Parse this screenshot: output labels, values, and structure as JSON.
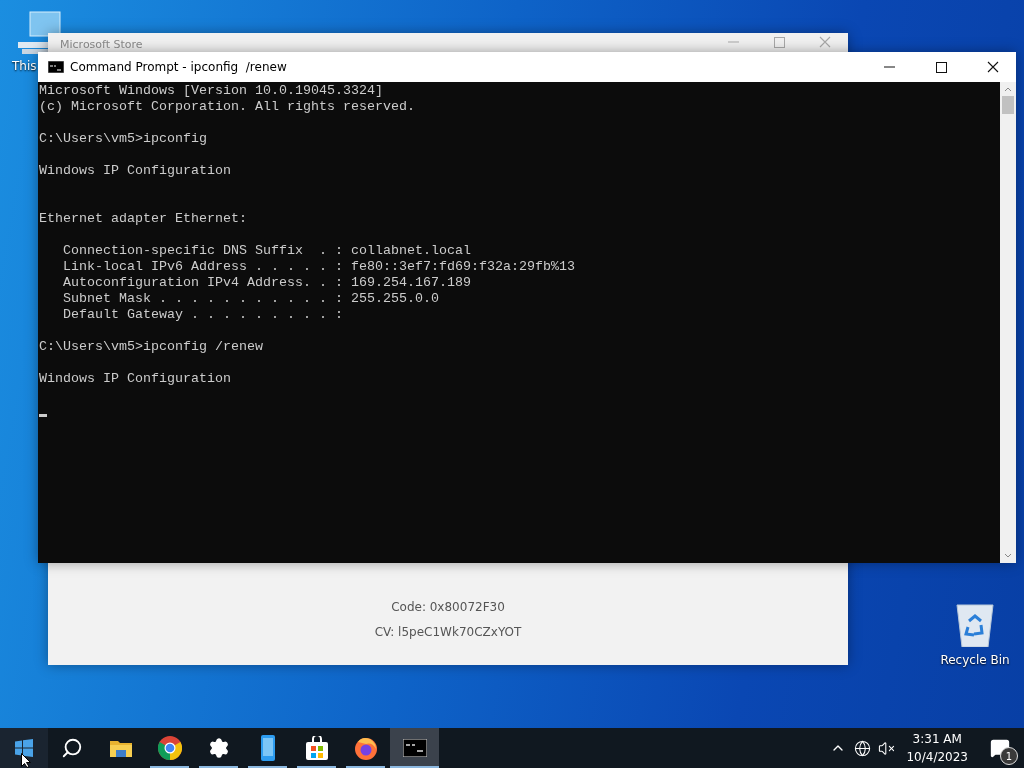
{
  "desktop_icons": [
    {
      "kind": "computer",
      "label": "This"
    },
    {
      "kind": "recycle",
      "label": "Recycle Bin"
    }
  ],
  "store_window": {
    "title": "Microsoft Store",
    "error_code": "Code: 0x80072F30",
    "cv": "CV: l5peC1Wk70CZxYOT"
  },
  "cmd_window": {
    "title": "Command Prompt - ipconfig  /renew",
    "blocks": [
      {
        "wide_gap": false,
        "lines": [
          "Microsoft Windows [Version 10.0.19045.3324]",
          "(c) Microsoft Corporation. All rights reserved."
        ]
      },
      {
        "wide_gap": false,
        "lines": [
          "C:\\Users\\vm5>ipconfig"
        ]
      },
      {
        "wide_gap": false,
        "lines": [
          "Windows IP Configuration"
        ]
      },
      {
        "wide_gap": true,
        "lines": [
          "Ethernet adapter Ethernet:"
        ]
      },
      {
        "wide_gap": false,
        "lines": [
          "   Connection-specific DNS Suffix  . : collabnet.local",
          "   Link-local IPv6 Address . . . . . : fe80::3ef7:fd69:f32a:29fb%13",
          "   Autoconfiguration IPv4 Address. . : 169.254.167.189",
          "   Subnet Mask . . . . . . . . . . . : 255.255.0.0",
          "   Default Gateway . . . . . . . . . :"
        ]
      },
      {
        "wide_gap": false,
        "lines": [
          "C:\\Users\\vm5>ipconfig /renew"
        ]
      },
      {
        "wide_gap": false,
        "lines": [
          "Windows IP Configuration"
        ]
      }
    ],
    "cursor": true
  },
  "taskbar": {
    "apps": [
      {
        "kind": "explorer",
        "running": false,
        "active": false
      },
      {
        "kind": "chrome",
        "running": true,
        "active": false
      },
      {
        "kind": "settings",
        "running": true,
        "active": false
      },
      {
        "kind": "phone",
        "running": true,
        "active": false
      },
      {
        "kind": "store",
        "running": true,
        "active": false
      },
      {
        "kind": "firefox",
        "running": true,
        "active": false
      },
      {
        "kind": "terminal",
        "running": true,
        "active": true
      }
    ],
    "clock": {
      "time": "3:31 AM",
      "date": "10/4/2023"
    },
    "notification_count": "1"
  }
}
